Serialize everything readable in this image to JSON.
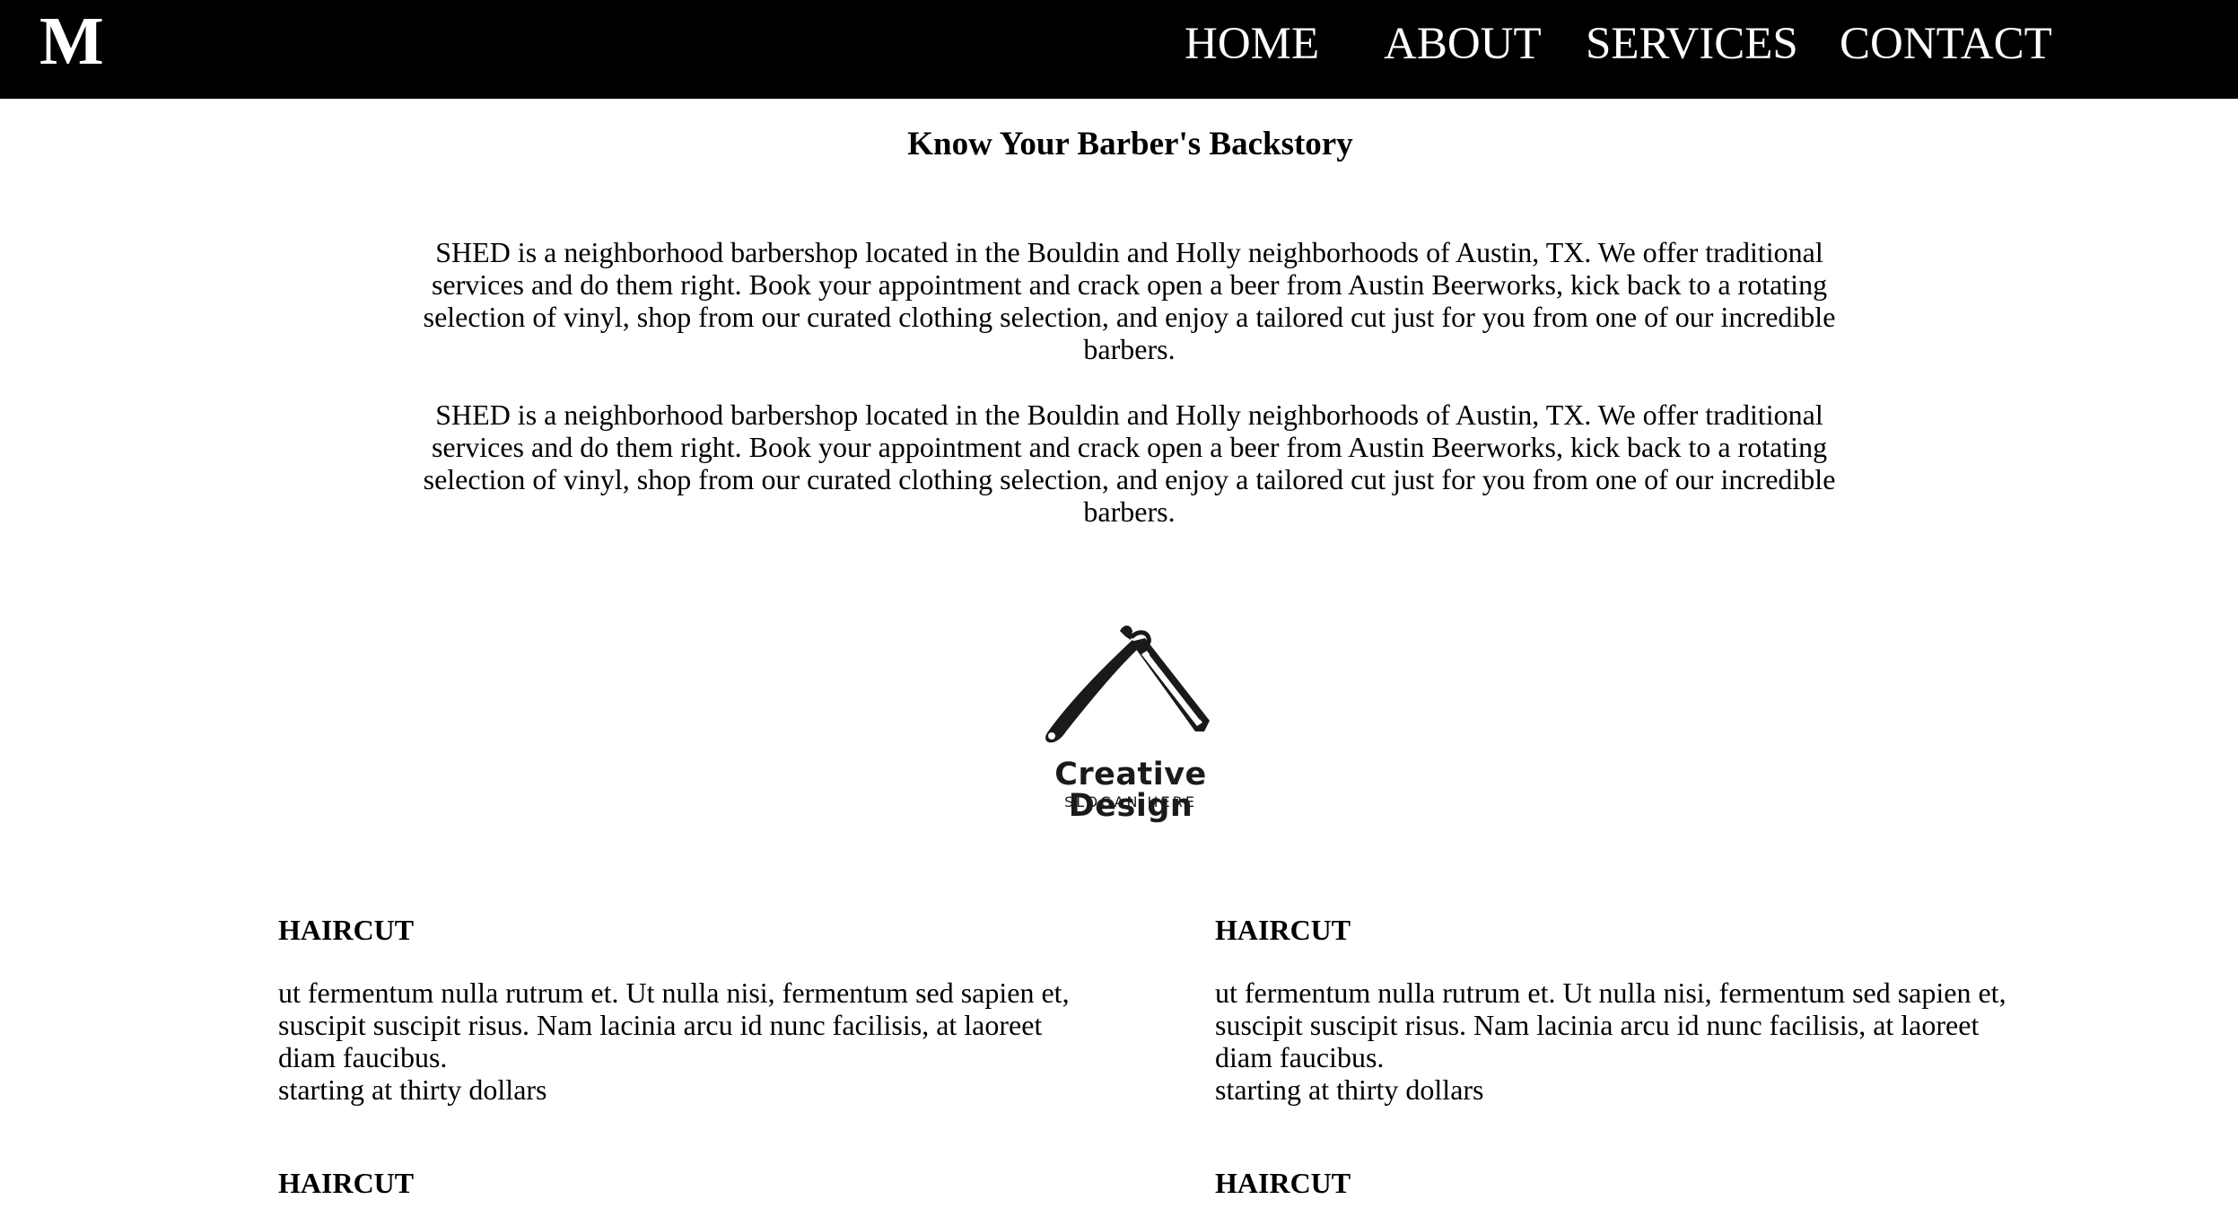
{
  "nav": {
    "brand": "M",
    "links": [
      "HOME",
      "ABOUT",
      "SERVICES",
      "CONTACT"
    ]
  },
  "main": {
    "title": "Know Your Barber's Backstory",
    "paragraphs": [
      "SHED is a neighborhood barbershop located in the Bouldin and Holly neighborhoods of Austin, TX. We offer traditional services and do them right. Book your appointment and crack open a beer from Austin Beerworks, kick back to a rotating selection of vinyl, shop from our curated clothing selection, and enjoy a tailored cut just for you from one of our incredible barbers.",
      "SHED is a neighborhood barbershop located in the Bouldin and Holly neighborhoods of Austin, TX. We offer traditional services and do them right. Book your appointment and crack open a beer from Austin Beerworks, kick back to a rotating selection of vinyl, shop from our curated clothing selection, and enjoy a tailored cut just for you from one of our incredible barbers."
    ]
  },
  "logo": {
    "icon": "straight-razor-icon",
    "title": "Creative Design",
    "slogan": "SLOGAN HERE"
  },
  "services": [
    {
      "title": "HAIRCUT",
      "description": "ut fermentum nulla rutrum et. Ut nulla nisi, fermentum sed sapien et, suscipit suscipit risus. Nam lacinia arcu id nunc facilisis, at laoreet diam faucibus.",
      "price": "starting at thirty dollars"
    },
    {
      "title": "HAIRCUT",
      "description": "ut fermentum nulla rutrum et. Ut nulla nisi, fermentum sed sapien et, suscipit suscipit risus. Nam lacinia arcu id nunc facilisis, at laoreet diam faucibus.",
      "price": "starting at thirty dollars"
    },
    {
      "title": "HAIRCUT"
    },
    {
      "title": "HAIRCUT"
    }
  ],
  "colors": {
    "navbar_bg": "#000000",
    "nav_text": "#ffffff",
    "page_bg": "#ffffff",
    "text": "#000000"
  }
}
